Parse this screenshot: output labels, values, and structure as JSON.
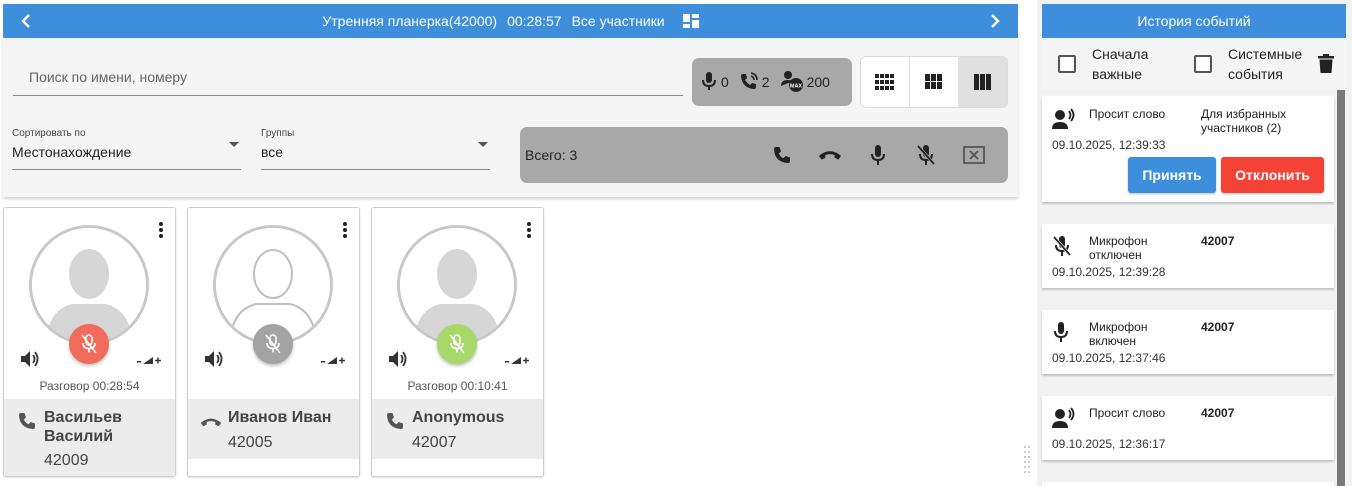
{
  "topbar": {
    "conference": "Утренняя планерка(42000)",
    "timer": "00:28:57",
    "filter": "Все участники"
  },
  "search": {
    "placeholder": "Поиск по имени, номеру"
  },
  "stats": {
    "speaking": "0",
    "calls": "2",
    "max": "200"
  },
  "sort": {
    "label": "Сортировать по",
    "value": "Местонахождение"
  },
  "groups": {
    "label": "Группы",
    "value": "все"
  },
  "actions": {
    "total": "Всего: 3"
  },
  "colors": {
    "accent": "#3d8fdc",
    "mic_red": "#f26b5b",
    "mic_gray": "#a3a3a3",
    "mic_green": "#a8d86a",
    "accept": "#3d8fdc",
    "reject": "#f44336"
  },
  "participants": [
    {
      "status_text": "Разговор 00:28:54",
      "name": "Васильев Василий",
      "number": "42009",
      "mic_state": "muted-red",
      "call_icon": "phone-icon"
    },
    {
      "status_text": "",
      "name": "Иванов Иван",
      "number": "42005",
      "mic_state": "muted-gray",
      "call_icon": "hangup-icon"
    },
    {
      "status_text": "Разговор 00:10:41",
      "name": "Anonymous",
      "number": "42007",
      "mic_state": "muted-green",
      "call_icon": "phone-icon"
    }
  ],
  "history": {
    "title": "История событий",
    "filter_important": "Сначала важные",
    "filter_system": "Системные события",
    "events": [
      {
        "type": "Просит слово",
        "detail": "Для избранных участников (2)",
        "time": "09.10.2025, 12:39:33",
        "icon": "raise-hand-icon",
        "accept": "Принять",
        "reject": "Отклонить"
      },
      {
        "type": "Микрофон отключен",
        "detail": "42007",
        "time": "09.10.2025, 12:39:28",
        "icon": "mic-off-icon"
      },
      {
        "type": "Микрофон включен",
        "detail": "42007",
        "time": "09.10.2025, 12:37:46",
        "icon": "mic-icon"
      },
      {
        "type": "Просит слово",
        "detail": "42007",
        "time": "09.10.2025, 12:36:17",
        "icon": "raise-hand-icon"
      }
    ]
  }
}
